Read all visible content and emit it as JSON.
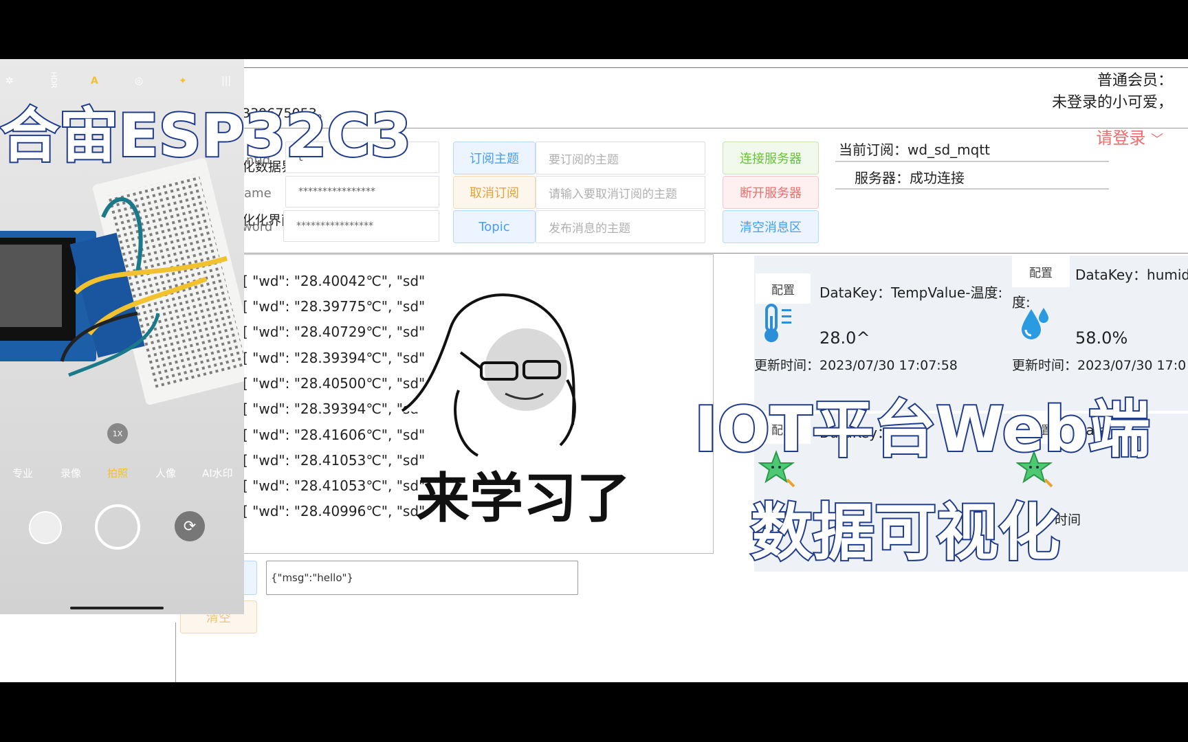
{
  "web": {
    "notice_lines": [
      "339675053。",
      "化数据界面。",
      "化化界面"
    ],
    "member_line1": "普通会员：",
    "member_line2": "未登录的小可爱，",
    "login_label": "请登录",
    "form": {
      "clientid_label": "ntId",
      "clientid_value": "t",
      "username_label": "ame",
      "username_value": "****************",
      "password_label": "word",
      "password_value": "****************"
    },
    "subscribe_button": "订阅主题",
    "subscribe_placeholder": "要订阅的主题",
    "unsubscribe_button": "取消订阅",
    "unsubscribe_placeholder": "请输入要取消订阅的主题",
    "topic_button": "Topic",
    "topic_placeholder": "发布消息的主题",
    "connect_button": "连接服务器",
    "disconnect_button": "断开服务器",
    "clear_messages_button": "清空消息区",
    "current_subscription": "当前订阅：wd_sd_mqtt",
    "server_status": "服务器：成功连接",
    "messages": [
      "[ \"wd\": \"28.40042℃\", \"sd\"",
      "[ \"wd\": \"28.39775℃\", \"sd\"",
      "[ \"wd\": \"28.40729℃\", \"sd\"",
      "[ \"wd\": \"28.39394℃\", \"sd\"",
      "[ \"wd\": \"28.40500℃\", \"sd\"",
      "[ \"wd\": \"28.39394℃\", \"sd\"",
      "[ \"wd\": \"28.41606℃\", \"sd\"",
      "[ \"wd\": \"28.41053℃\", \"sd\"",
      "[ \"wd\": \"28.41053℃\", \"sd\"",
      "[ \"wd\": \"28.40996℃\", \"sd\""
    ],
    "publish_value": "{\"msg\":\"hello\"}",
    "clear_button": "清空",
    "cards": [
      {
        "config": "配置",
        "key": "DataKey：TempValue-温度:",
        "value": "28.0^",
        "time": "更新时间：2023/07/30 17:07:58"
      },
      {
        "config": "配置",
        "key": "DataKey：humidi",
        "key2": "度:",
        "value": "58.0%",
        "time": "更新时间：2023/07/30 17:0"
      },
      {
        "config": "配置",
        "key": "DataKey：-"
      },
      {
        "config": "配置",
        "key": "Data",
        "time": "时间"
      }
    ]
  },
  "phone": {
    "top_icons": [
      "✲",
      "HDR",
      "A",
      "◎",
      "✦",
      "|||"
    ],
    "modes": [
      "专业",
      "录像",
      "拍照",
      "人像",
      "AI水印"
    ],
    "zoom_label": "1X"
  },
  "overlay": {
    "title_left": "合宙ESP32C3",
    "title_right1": "IOT平台Web端",
    "title_right2": "数据可视化",
    "meme_caption": "来学习了"
  }
}
